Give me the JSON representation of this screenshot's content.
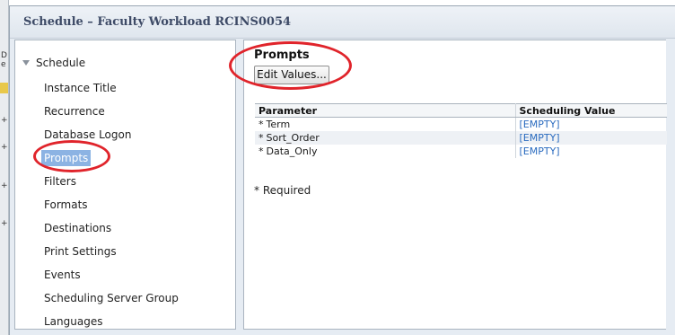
{
  "window": {
    "title": "Schedule – Faculty Workload RCINS0054"
  },
  "nav": {
    "root_label": "Schedule",
    "items": [
      {
        "label": "Instance Title",
        "selected": false
      },
      {
        "label": "Recurrence",
        "selected": false
      },
      {
        "label": "Database Logon",
        "selected": false
      },
      {
        "label": "Prompts",
        "selected": true
      },
      {
        "label": "Filters",
        "selected": false
      },
      {
        "label": "Formats",
        "selected": false
      },
      {
        "label": "Destinations",
        "selected": false
      },
      {
        "label": "Print Settings",
        "selected": false
      },
      {
        "label": "Events",
        "selected": false
      },
      {
        "label": "Scheduling Server Group",
        "selected": false
      },
      {
        "label": "Languages",
        "selected": false
      }
    ]
  },
  "prompts": {
    "heading": "Prompts",
    "edit_button": "Edit Values...",
    "table": {
      "headers": [
        "Parameter",
        "Scheduling Value"
      ],
      "rows": [
        {
          "required": "*",
          "parameter": "Term",
          "value": "[EMPTY]"
        },
        {
          "required": "*",
          "parameter": "Sort_Order",
          "value": "[EMPTY]"
        },
        {
          "required": "*",
          "parameter": "Data_Only",
          "value": "[EMPTY]"
        }
      ]
    },
    "required_note": "* Required"
  },
  "colors": {
    "annotation": "#e0242b",
    "selected_bg": "#8cb3e3",
    "link": "#2a6bbf",
    "title_text": "#3d4a66"
  }
}
